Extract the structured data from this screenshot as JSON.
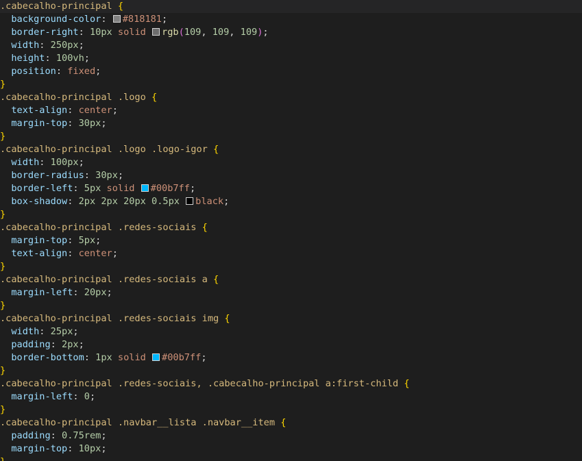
{
  "editor": {
    "language": "css",
    "colors": {
      "background": "#1e1e1e",
      "selector": "#d7ba7d",
      "brace": "#ffd700",
      "property": "#9cdcfe",
      "number": "#b5cea8",
      "string": "#ce9178",
      "function": "#dcdcaa"
    },
    "lines": [
      [
        {
          "t": "selector",
          "v": ".cabecalho-principal"
        },
        {
          "t": "punct",
          "v": " "
        },
        {
          "t": "brace",
          "v": "{"
        }
      ],
      [
        {
          "t": "punct",
          "v": "  "
        },
        {
          "t": "prop",
          "v": "background-color"
        },
        {
          "t": "punct",
          "v": ": "
        },
        {
          "t": "swatch",
          "color": "#818181"
        },
        {
          "t": "str",
          "v": "#818181"
        },
        {
          "t": "punct",
          "v": ";"
        }
      ],
      [
        {
          "t": "punct",
          "v": "  "
        },
        {
          "t": "prop",
          "v": "border-right"
        },
        {
          "t": "punct",
          "v": ": "
        },
        {
          "t": "num",
          "v": "10px"
        },
        {
          "t": "punct",
          "v": " "
        },
        {
          "t": "str",
          "v": "solid"
        },
        {
          "t": "punct",
          "v": " "
        },
        {
          "t": "swatch",
          "color": "#6d6d6d"
        },
        {
          "t": "fn",
          "v": "rgb"
        },
        {
          "t": "paren",
          "v": "("
        },
        {
          "t": "num",
          "v": "109"
        },
        {
          "t": "punct",
          "v": ", "
        },
        {
          "t": "num",
          "v": "109"
        },
        {
          "t": "punct",
          "v": ", "
        },
        {
          "t": "num",
          "v": "109"
        },
        {
          "t": "paren",
          "v": ")"
        },
        {
          "t": "punct",
          "v": ";"
        }
      ],
      [
        {
          "t": "punct",
          "v": "  "
        },
        {
          "t": "prop",
          "v": "width"
        },
        {
          "t": "punct",
          "v": ": "
        },
        {
          "t": "num",
          "v": "250px"
        },
        {
          "t": "punct",
          "v": ";"
        }
      ],
      [
        {
          "t": "punct",
          "v": "  "
        },
        {
          "t": "prop",
          "v": "height"
        },
        {
          "t": "punct",
          "v": ": "
        },
        {
          "t": "num",
          "v": "100vh"
        },
        {
          "t": "punct",
          "v": ";"
        }
      ],
      [
        {
          "t": "punct",
          "v": "  "
        },
        {
          "t": "prop",
          "v": "position"
        },
        {
          "t": "punct",
          "v": ": "
        },
        {
          "t": "str",
          "v": "fixed"
        },
        {
          "t": "punct",
          "v": ";"
        }
      ],
      [
        {
          "t": "brace",
          "v": "}"
        }
      ],
      [
        {
          "t": "selector",
          "v": ".cabecalho-principal .logo"
        },
        {
          "t": "punct",
          "v": " "
        },
        {
          "t": "brace",
          "v": "{"
        }
      ],
      [
        {
          "t": "punct",
          "v": "  "
        },
        {
          "t": "prop",
          "v": "text-align"
        },
        {
          "t": "punct",
          "v": ": "
        },
        {
          "t": "str",
          "v": "center"
        },
        {
          "t": "punct",
          "v": ";"
        }
      ],
      [
        {
          "t": "punct",
          "v": "  "
        },
        {
          "t": "prop",
          "v": "margin-top"
        },
        {
          "t": "punct",
          "v": ": "
        },
        {
          "t": "num",
          "v": "30px"
        },
        {
          "t": "punct",
          "v": ";"
        }
      ],
      [
        {
          "t": "brace",
          "v": "}"
        }
      ],
      [
        {
          "t": "selector",
          "v": ".cabecalho-principal .logo .logo-igor"
        },
        {
          "t": "punct",
          "v": " "
        },
        {
          "t": "brace",
          "v": "{"
        }
      ],
      [
        {
          "t": "punct",
          "v": "  "
        },
        {
          "t": "prop",
          "v": "width"
        },
        {
          "t": "punct",
          "v": ": "
        },
        {
          "t": "num",
          "v": "100px"
        },
        {
          "t": "punct",
          "v": ";"
        }
      ],
      [
        {
          "t": "punct",
          "v": "  "
        },
        {
          "t": "prop",
          "v": "border-radius"
        },
        {
          "t": "punct",
          "v": ": "
        },
        {
          "t": "num",
          "v": "30px"
        },
        {
          "t": "punct",
          "v": ";"
        }
      ],
      [
        {
          "t": "punct",
          "v": "  "
        },
        {
          "t": "prop",
          "v": "border-left"
        },
        {
          "t": "punct",
          "v": ": "
        },
        {
          "t": "num",
          "v": "5px"
        },
        {
          "t": "punct",
          "v": " "
        },
        {
          "t": "str",
          "v": "solid"
        },
        {
          "t": "punct",
          "v": " "
        },
        {
          "t": "swatch",
          "color": "#00b7ff"
        },
        {
          "t": "str",
          "v": "#00b7ff"
        },
        {
          "t": "punct",
          "v": ";"
        }
      ],
      [
        {
          "t": "punct",
          "v": "  "
        },
        {
          "t": "prop",
          "v": "box-shadow"
        },
        {
          "t": "punct",
          "v": ": "
        },
        {
          "t": "num",
          "v": "2px"
        },
        {
          "t": "punct",
          "v": " "
        },
        {
          "t": "num",
          "v": "2px"
        },
        {
          "t": "punct",
          "v": " "
        },
        {
          "t": "num",
          "v": "20px"
        },
        {
          "t": "punct",
          "v": " "
        },
        {
          "t": "num",
          "v": "0.5px"
        },
        {
          "t": "punct",
          "v": " "
        },
        {
          "t": "swatch",
          "color": "#000000"
        },
        {
          "t": "str",
          "v": "black"
        },
        {
          "t": "punct",
          "v": ";"
        }
      ],
      [
        {
          "t": "brace",
          "v": "}"
        }
      ],
      [
        {
          "t": "selector",
          "v": ".cabecalho-principal .redes-sociais"
        },
        {
          "t": "punct",
          "v": " "
        },
        {
          "t": "brace",
          "v": "{"
        }
      ],
      [
        {
          "t": "punct",
          "v": "  "
        },
        {
          "t": "prop",
          "v": "margin-top"
        },
        {
          "t": "punct",
          "v": ": "
        },
        {
          "t": "num",
          "v": "5px"
        },
        {
          "t": "punct",
          "v": ";"
        }
      ],
      [
        {
          "t": "punct",
          "v": "  "
        },
        {
          "t": "prop",
          "v": "text-align"
        },
        {
          "t": "punct",
          "v": ": "
        },
        {
          "t": "str",
          "v": "center"
        },
        {
          "t": "punct",
          "v": ";"
        }
      ],
      [
        {
          "t": "brace",
          "v": "}"
        }
      ],
      [
        {
          "t": "selector",
          "v": ".cabecalho-principal .redes-sociais a"
        },
        {
          "t": "punct",
          "v": " "
        },
        {
          "t": "brace",
          "v": "{"
        }
      ],
      [
        {
          "t": "punct",
          "v": "  "
        },
        {
          "t": "prop",
          "v": "margin-left"
        },
        {
          "t": "punct",
          "v": ": "
        },
        {
          "t": "num",
          "v": "20px"
        },
        {
          "t": "punct",
          "v": ";"
        }
      ],
      [
        {
          "t": "brace",
          "v": "}"
        }
      ],
      [
        {
          "t": "selector",
          "v": ".cabecalho-principal .redes-sociais img"
        },
        {
          "t": "punct",
          "v": " "
        },
        {
          "t": "brace",
          "v": "{"
        }
      ],
      [
        {
          "t": "punct",
          "v": "  "
        },
        {
          "t": "prop",
          "v": "width"
        },
        {
          "t": "punct",
          "v": ": "
        },
        {
          "t": "num",
          "v": "25px"
        },
        {
          "t": "punct",
          "v": ";"
        }
      ],
      [
        {
          "t": "punct",
          "v": "  "
        },
        {
          "t": "prop",
          "v": "padding"
        },
        {
          "t": "punct",
          "v": ": "
        },
        {
          "t": "num",
          "v": "2px"
        },
        {
          "t": "punct",
          "v": ";"
        }
      ],
      [
        {
          "t": "punct",
          "v": "  "
        },
        {
          "t": "prop",
          "v": "border-bottom"
        },
        {
          "t": "punct",
          "v": ": "
        },
        {
          "t": "num",
          "v": "1px"
        },
        {
          "t": "punct",
          "v": " "
        },
        {
          "t": "str",
          "v": "solid"
        },
        {
          "t": "punct",
          "v": " "
        },
        {
          "t": "swatch",
          "color": "#00b7ff"
        },
        {
          "t": "str",
          "v": "#00b7ff"
        },
        {
          "t": "punct",
          "v": ";"
        }
      ],
      [
        {
          "t": "brace",
          "v": "}"
        }
      ],
      [
        {
          "t": "selector",
          "v": ".cabecalho-principal .redes-sociais, .cabecalho-principal a:first-child"
        },
        {
          "t": "punct",
          "v": " "
        },
        {
          "t": "brace",
          "v": "{"
        }
      ],
      [
        {
          "t": "punct",
          "v": "  "
        },
        {
          "t": "prop",
          "v": "margin-left"
        },
        {
          "t": "punct",
          "v": ": "
        },
        {
          "t": "num",
          "v": "0"
        },
        {
          "t": "punct",
          "v": ";"
        }
      ],
      [
        {
          "t": "brace",
          "v": "}"
        }
      ],
      [
        {
          "t": "selector",
          "v": ".cabecalho-principal .navbar__lista .navbar__item"
        },
        {
          "t": "punct",
          "v": " "
        },
        {
          "t": "brace",
          "v": "{"
        }
      ],
      [
        {
          "t": "punct",
          "v": "  "
        },
        {
          "t": "prop",
          "v": "padding"
        },
        {
          "t": "punct",
          "v": ": "
        },
        {
          "t": "num",
          "v": "0.75rem"
        },
        {
          "t": "punct",
          "v": ";"
        }
      ],
      [
        {
          "t": "punct",
          "v": "  "
        },
        {
          "t": "prop",
          "v": "margin-top"
        },
        {
          "t": "punct",
          "v": ": "
        },
        {
          "t": "num",
          "v": "10px"
        },
        {
          "t": "punct",
          "v": ";"
        }
      ],
      [
        {
          "t": "brace",
          "v": "}"
        }
      ]
    ]
  }
}
